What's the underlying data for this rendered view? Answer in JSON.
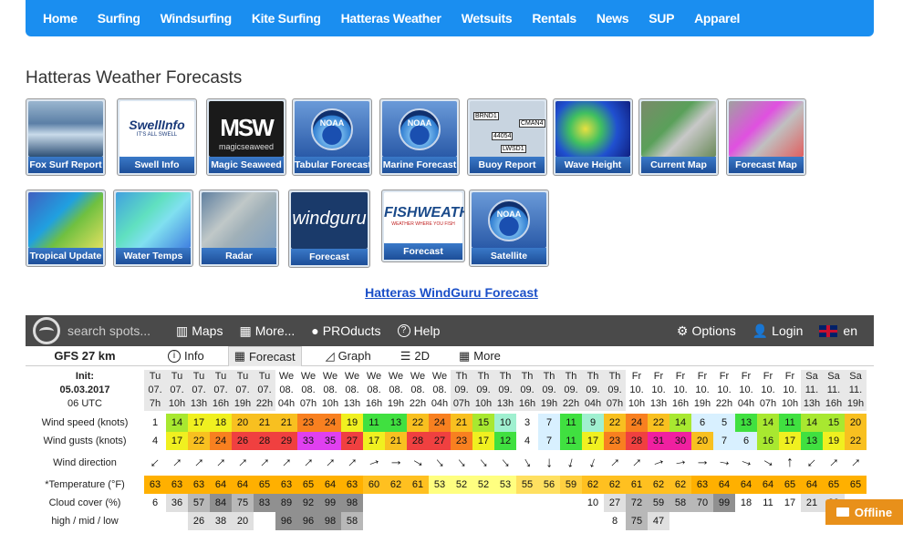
{
  "nav": [
    "Home",
    "Surfing",
    "Windsurfing",
    "Kite Surfing",
    "Hatteras Weather",
    "Wetsuits",
    "Rentals",
    "News",
    "SUP",
    "Apparel"
  ],
  "page_title": "Hatteras Weather Forecasts",
  "tiles_row1": [
    "Fox Surf Report",
    "Swell Info",
    "Magic Seaweed",
    "Tabular Forecast",
    "Marine Forecast",
    "Buoy Report",
    "Wave Height",
    "Current Map",
    "Forecast Map"
  ],
  "tiles_row2": [
    "Tropical Update",
    "Water Temps",
    "Radar",
    "Forecast",
    "Forecast",
    "Satellite"
  ],
  "tile_texts": {
    "swellinfo": "SwellInfo",
    "swellinfo_sub": "IT'S ALL SWELL",
    "msw": "magicseaweed",
    "noaa": "NOAA",
    "windguru": "windguru",
    "fishweather": "FISHWEATHER",
    "fishweather_sub": "WEATHER WHERE YOU FISH",
    "buoys": [
      "BRND1",
      "CMAN4",
      "44054",
      "LWSD1"
    ]
  },
  "windguru_link": "Hatteras WindGuru Forecast",
  "wg_bar": {
    "search": "search spots...",
    "maps": "Maps",
    "more": "More...",
    "products": "PROducts",
    "help": "Help",
    "options": "Options",
    "login": "Login",
    "lang": "en"
  },
  "wg_tabs": {
    "model": "GFS 27 km",
    "info": "Info",
    "forecast": "Forecast",
    "graph": "Graph",
    "twod": "2D",
    "more": "More"
  },
  "init": {
    "label": "Init:",
    "date": "05.03.2017",
    "time": "06 UTC"
  },
  "columns": {
    "day": [
      "Tu",
      "Tu",
      "Tu",
      "Tu",
      "Tu",
      "Tu",
      "We",
      "We",
      "We",
      "We",
      "We",
      "We",
      "We",
      "We",
      "Th",
      "Th",
      "Th",
      "Th",
      "Th",
      "Th",
      "Th",
      "Th",
      "Fr",
      "Fr",
      "Fr",
      "Fr",
      "Fr",
      "Fr",
      "Fr",
      "Fr",
      "Sa",
      "Sa",
      "Sa",
      "Sa",
      "Sa",
      "Sa",
      "Sa",
      "Sa"
    ],
    "date": [
      "07.",
      "07.",
      "07.",
      "07.",
      "07.",
      "07.",
      "08.",
      "08.",
      "08.",
      "08.",
      "08.",
      "08.",
      "08.",
      "08.",
      "09.",
      "09.",
      "09.",
      "09.",
      "09.",
      "09.",
      "09.",
      "09.",
      "10.",
      "10.",
      "10.",
      "10.",
      "10.",
      "10.",
      "10.",
      "10.",
      "11.",
      "11.",
      "11.",
      "11.",
      "11.",
      "11.",
      "11.",
      "11."
    ],
    "hour": [
      "7h",
      "10h",
      "13h",
      "16h",
      "19h",
      "22h",
      "04h",
      "07h",
      "10h",
      "13h",
      "16h",
      "19h",
      "22h",
      "04h",
      "07h",
      "10h",
      "13h",
      "16h",
      "19h",
      "22h",
      "04h",
      "07h",
      "10h",
      "13h",
      "16h",
      "19h",
      "22h",
      "04h",
      "07h",
      "10h",
      "13h",
      "16h",
      "19h",
      "22h",
      "04h",
      "07h",
      "10h",
      "13h"
    ]
  },
  "labels": {
    "wind_speed": "Wind speed (knots)",
    "wind_gusts": "Wind gusts (knots)",
    "wind_dir": "Wind direction",
    "temp": "*Temperature (°F)",
    "cloud": "Cloud cover (%)",
    "cloud_sub": "high / mid / low"
  },
  "wind_speed": [
    "1",
    "14",
    "17",
    "18",
    "20",
    "21",
    "21",
    "23",
    "24",
    "19",
    "11",
    "13",
    "22",
    "24",
    "21",
    "15",
    "10",
    "3",
    "7",
    "11",
    "9",
    "22",
    "24",
    "22",
    "14",
    "6",
    "5",
    "13",
    "14",
    "11",
    "14",
    "15",
    "20",
    "19"
  ],
  "wind_gusts": [
    "4",
    "17",
    "22",
    "24",
    "26",
    "28",
    "29",
    "33",
    "35",
    "27",
    "17",
    "21",
    "28",
    "27",
    "23",
    "17",
    "12",
    "4",
    "7",
    "11",
    "17",
    "23",
    "28",
    "31",
    "30",
    "20",
    "7",
    "6",
    "16",
    "17",
    "13",
    "19",
    "22",
    "30",
    "29"
  ],
  "wind_dir_deg": [
    45,
    225,
    225,
    225,
    225,
    225,
    225,
    225,
    225,
    225,
    250,
    270,
    300,
    320,
    320,
    320,
    320,
    330,
    0,
    15,
    20,
    225,
    225,
    250,
    260,
    270,
    280,
    290,
    300,
    180,
    45,
    225,
    225,
    225,
    235,
    240,
    240,
    240
  ],
  "temperature": [
    "63",
    "63",
    "63",
    "64",
    "64",
    "65",
    "63",
    "65",
    "64",
    "63",
    "60",
    "62",
    "61",
    "53",
    "52",
    "52",
    "53",
    "55",
    "56",
    "59",
    "62",
    "62",
    "61",
    "62",
    "62",
    "63",
    "64",
    "64",
    "64",
    "65",
    "64",
    "65",
    "65",
    "66"
  ],
  "cloud_cover": [
    "6",
    "36",
    "57",
    "84",
    "75",
    "83",
    "89",
    "92",
    "99",
    "98",
    "",
    "",
    "",
    "",
    "",
    "",
    "",
    "",
    "",
    "",
    "10",
    "27",
    "72",
    "59",
    "58",
    "70",
    "99",
    "18",
    "11",
    "17",
    "21",
    "29"
  ],
  "cloud_sub_vals": [
    "",
    "",
    "26",
    "38",
    "20",
    "",
    "96",
    "96",
    "98",
    "58",
    "",
    "",
    "",
    "",
    "",
    "",
    "",
    "",
    "",
    "",
    "",
    "8",
    "75",
    "47"
  ],
  "offline": "Offline"
}
